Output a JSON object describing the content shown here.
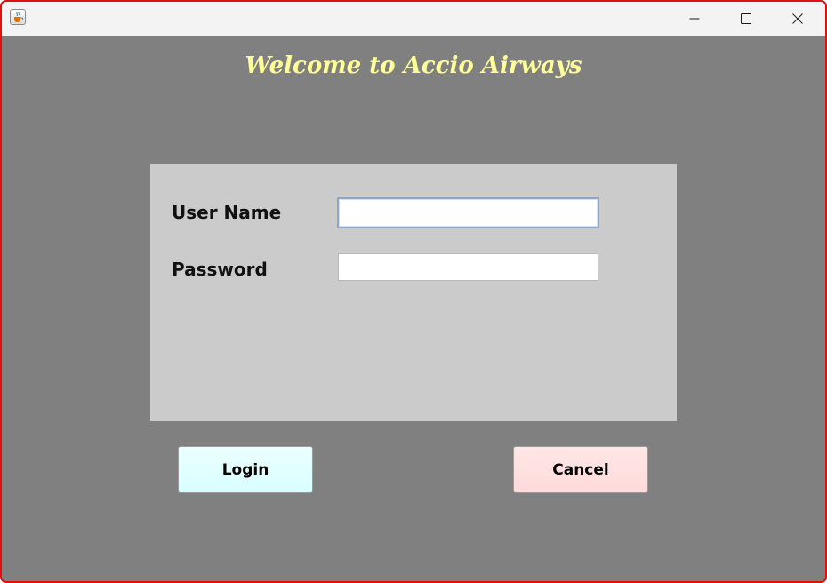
{
  "window": {
    "title": "",
    "icons": {
      "app": "java-cup-icon",
      "minimize": "minimize-icon",
      "maximize": "maximize-icon",
      "close": "close-icon"
    }
  },
  "header": {
    "welcome_text": "Welcome to Accio Airways"
  },
  "form": {
    "username_label": "User Name",
    "username_value": "",
    "password_label": "Password",
    "password_value": ""
  },
  "buttons": {
    "login_label": "Login",
    "cancel_label": "Cancel"
  },
  "colors": {
    "window_border": "#e01010",
    "background": "#808080",
    "panel": "#cbcbcb",
    "welcome_text": "#ffff99",
    "login_button": "#dcffff",
    "cancel_button": "#ffdede"
  }
}
